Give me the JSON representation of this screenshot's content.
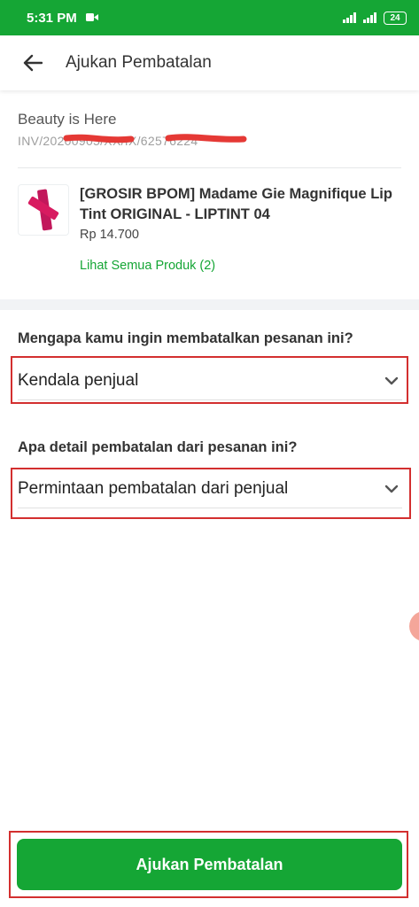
{
  "status_bar": {
    "time": "5:31 PM",
    "battery": "24"
  },
  "app_bar": {
    "title": "Ajukan Pembatalan"
  },
  "order": {
    "shop_name": "Beauty is Here",
    "invoice": "INV/20200905/XX/IX/62576224",
    "product_name": "[GROSIR BPOM] Madame Gie Magnifique Lip Tint ORIGINAL - LIPTINT 04",
    "price": "Rp 14.700",
    "see_all_link": "Lihat Semua Produk (2)"
  },
  "form": {
    "reason_question": "Mengapa kamu ingin membatalkan pesanan ini?",
    "reason_value": "Kendala penjual",
    "detail_question": "Apa detail pembatalan dari pesanan ini?",
    "detail_value": "Permintaan pembatalan dari penjual"
  },
  "submit_label": "Ajukan Pembatalan",
  "colors": {
    "brand_green": "#15a635",
    "highlight_red": "#d32f2f",
    "redaction": "#e53935"
  }
}
